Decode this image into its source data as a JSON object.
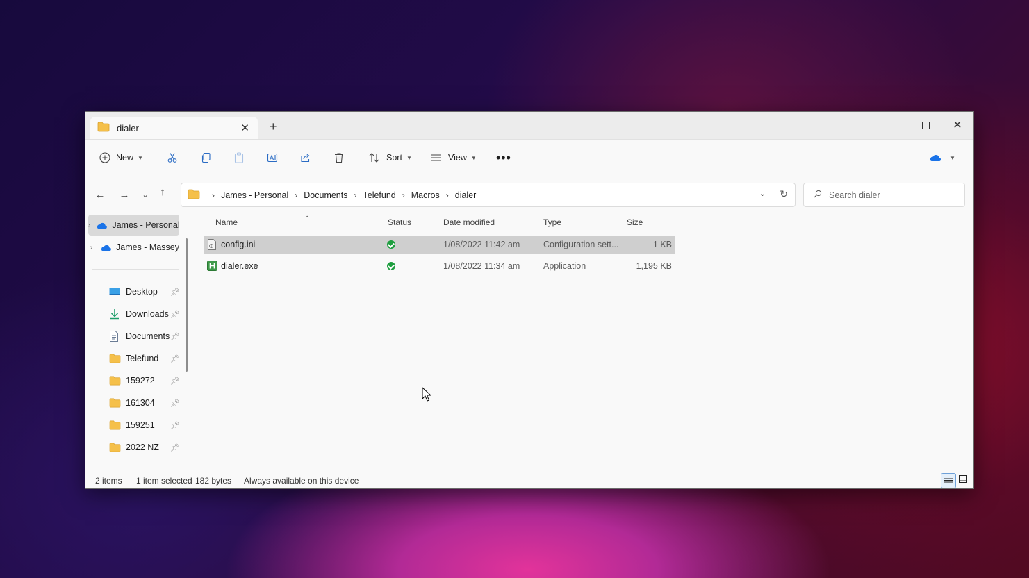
{
  "tab": {
    "title": "dialer"
  },
  "commandbar": {
    "new_label": "New",
    "sort_label": "Sort",
    "view_label": "View"
  },
  "address": {
    "crumbs": [
      "James - Personal",
      "Documents",
      "Telefund",
      "Macros",
      "dialer"
    ]
  },
  "search": {
    "placeholder": "Search dialer"
  },
  "navpane": {
    "cloud_items": [
      {
        "label": "James - Personal",
        "selected": true
      },
      {
        "label": "James - Massey",
        "selected": false
      }
    ],
    "quick_access": [
      {
        "label": "Desktop",
        "icon": "desktop-icon"
      },
      {
        "label": "Downloads",
        "icon": "download-icon"
      },
      {
        "label": "Documents",
        "icon": "document-icon"
      },
      {
        "label": "Telefund",
        "icon": "folder-icon"
      },
      {
        "label": "159272",
        "icon": "folder-icon"
      },
      {
        "label": "161304",
        "icon": "folder-icon"
      },
      {
        "label": "159251",
        "icon": "folder-icon"
      },
      {
        "label": "2022 NZ",
        "icon": "folder-icon"
      }
    ]
  },
  "columns": {
    "name": "Name",
    "status": "Status",
    "date": "Date modified",
    "type": "Type",
    "size": "Size"
  },
  "files": [
    {
      "name": "config.ini",
      "date": "1/08/2022 11:42 am",
      "type": "Configuration sett...",
      "size": "1 KB",
      "selected": true,
      "icon": "ini-file-icon"
    },
    {
      "name": "dialer.exe",
      "date": "1/08/2022 11:34 am",
      "type": "Application",
      "size": "1,195 KB",
      "selected": false,
      "icon": "exe-file-icon"
    }
  ],
  "statusbar": {
    "count": "2 items",
    "selection": "1 item selected",
    "bytes": "182 bytes",
    "availability": "Always available on this device"
  },
  "colors": {
    "onedrive": "#1a73e8",
    "folder": "#f5c04a",
    "status_ok": "#1e9e3f",
    "selection": "#cfcfcf"
  }
}
